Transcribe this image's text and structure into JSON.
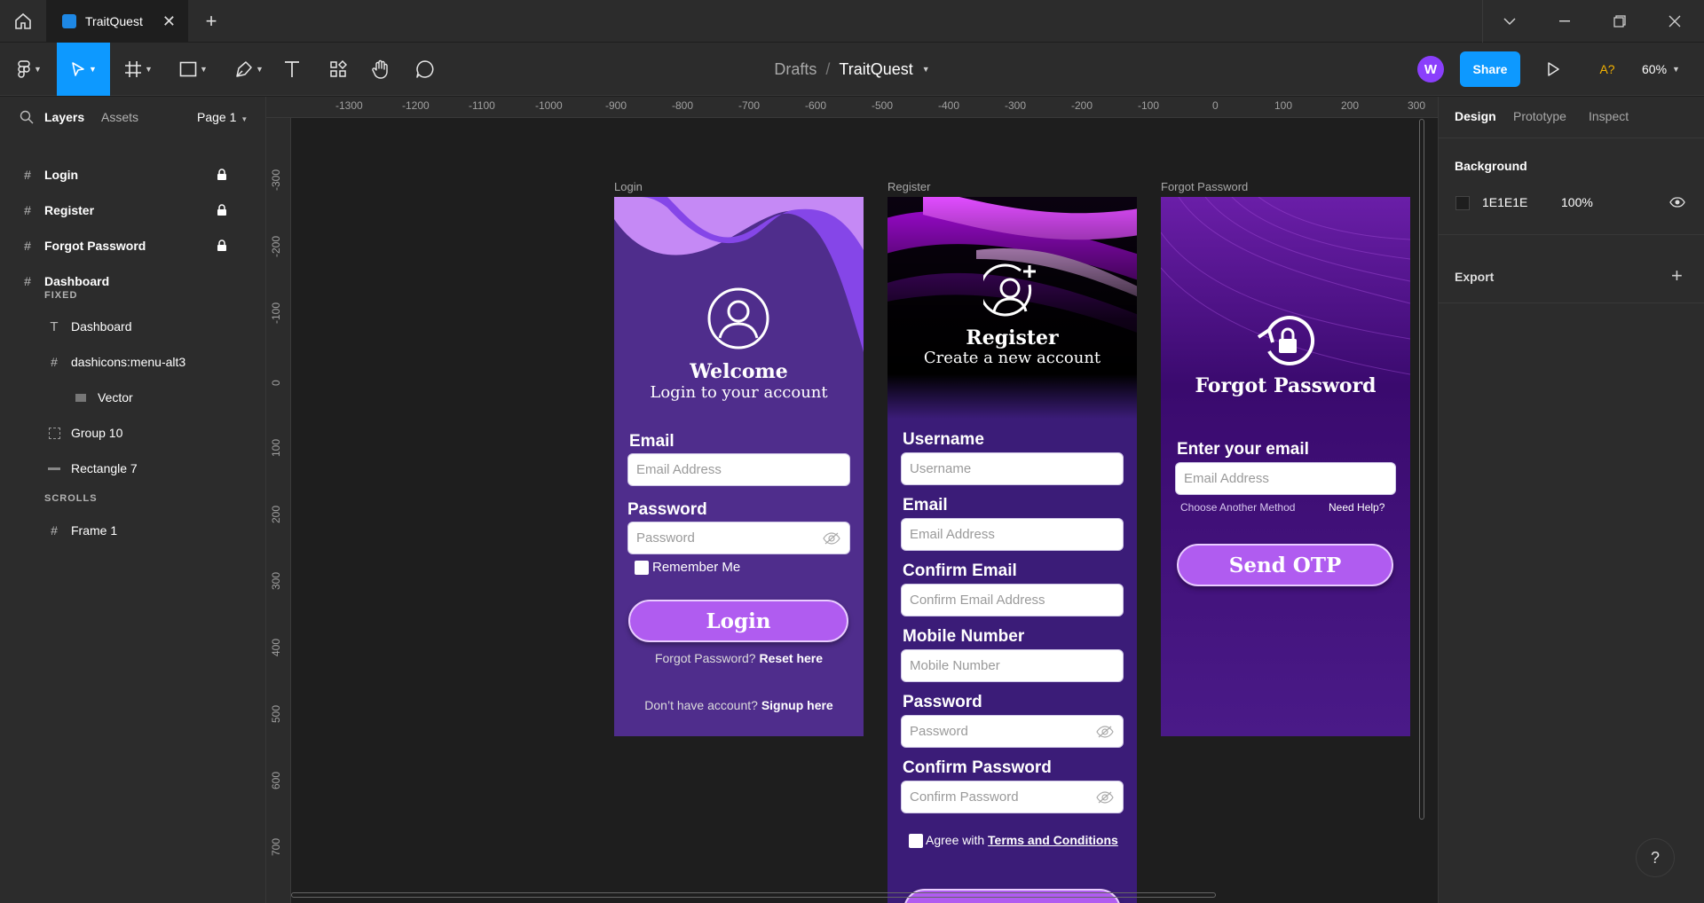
{
  "tabbar": {
    "tab_title": "TraitQuest",
    "close_glyph": "✕",
    "new_tab_glyph": "+"
  },
  "toolbar": {
    "breadcrumb_parent": "Drafts",
    "breadcrumb_separator": "/",
    "file_name": "TraitQuest",
    "avatar_initial": "W",
    "share_label": "Share",
    "font_warning": "A?",
    "zoom_level": "60%",
    "tools": [
      "main-menu",
      "move",
      "frame",
      "shape",
      "pen",
      "text",
      "resources",
      "hand",
      "comment"
    ]
  },
  "left_panel": {
    "tabs": {
      "layers": "Layers",
      "assets": "Assets",
      "page": "Page 1"
    },
    "layers": [
      {
        "label": "Login",
        "locked": true
      },
      {
        "label": "Register",
        "locked": true
      },
      {
        "label": "Forgot Password",
        "locked": true
      },
      {
        "label": "Dashboard",
        "locked": false
      }
    ],
    "fixed_label": "FIXED",
    "fixed_children": [
      {
        "label": "Dashboard",
        "icon": "text-icon"
      },
      {
        "label": "dashicons:menu-alt3",
        "icon": "frame-icon"
      },
      {
        "label": "Vector",
        "icon": "vector-icon"
      },
      {
        "label": "Group 10",
        "icon": "group-icon"
      },
      {
        "label": "Rectangle 7",
        "icon": "rectangle-icon"
      }
    ],
    "scrolls_label": "SCROLLS",
    "scrolls_children": [
      {
        "label": "Frame 1",
        "icon": "frame-icon"
      }
    ]
  },
  "rulers": {
    "horizontal": [
      "-1300",
      "-1200",
      "-1100",
      "-1000",
      "-900",
      "-800",
      "-700",
      "-600",
      "-500",
      "-400",
      "-300",
      "-200",
      "-100",
      "0",
      "100",
      "200",
      "300"
    ],
    "vertical": [
      "-300",
      "-200",
      "-100",
      "0",
      "100",
      "200",
      "300",
      "400",
      "500",
      "600",
      "700"
    ]
  },
  "frames": {
    "login": {
      "frame_label": "Login",
      "title": "Welcome",
      "subtitle": "Login to your account",
      "email_label": "Email",
      "email_placeholder": "Email Address",
      "password_label": "Password",
      "password_placeholder": "Password",
      "remember_label": "Remember Me",
      "button_label": "Login",
      "forgot_text": "Forgot Password?",
      "forgot_link": "Reset here",
      "signup_text": "Don’t have account?",
      "signup_link": "Signup here"
    },
    "register": {
      "frame_label": "Register",
      "title": "Register",
      "subtitle": "Create a new account",
      "username_label": "Username",
      "username_placeholder": "Username",
      "email_label": "Email",
      "email_placeholder": "Email Address",
      "confirm_email_label": "Confirm Email",
      "confirm_email_placeholder": "Confirm Email Address",
      "mobile_label": "Mobile Number",
      "mobile_placeholder": "Mobile Number",
      "password_label": "Password",
      "password_placeholder": "Password",
      "confirm_password_label": "Confirm Password",
      "confirm_password_placeholder": "Confirm Password",
      "agree_text": "Agree with",
      "terms_link": "Terms and Conditions"
    },
    "forgot": {
      "frame_label": "Forgot Password",
      "title": "Forgot Password",
      "email_label": "Enter your email",
      "email_placeholder": "Email Address",
      "other_method": "Choose Another Method",
      "need_help": "Need Help?",
      "button_label": "Send OTP"
    }
  },
  "right_panel": {
    "tabs": [
      "Design",
      "Prototype",
      "Inspect"
    ],
    "active_tab": "Design",
    "background_title": "Background",
    "background_hex": "1E1E1E",
    "background_opacity": "100%",
    "export_title": "Export",
    "export_add": "+"
  },
  "help_glyph": "?",
  "colors": {
    "accent": "#0d99ff",
    "avatar": "#8a3ffc",
    "button_purple": "#b05cf0",
    "login_bg": "#4f2d8c",
    "register_bg": "#3b1c78",
    "forgot_bg": "#4a1a88"
  }
}
